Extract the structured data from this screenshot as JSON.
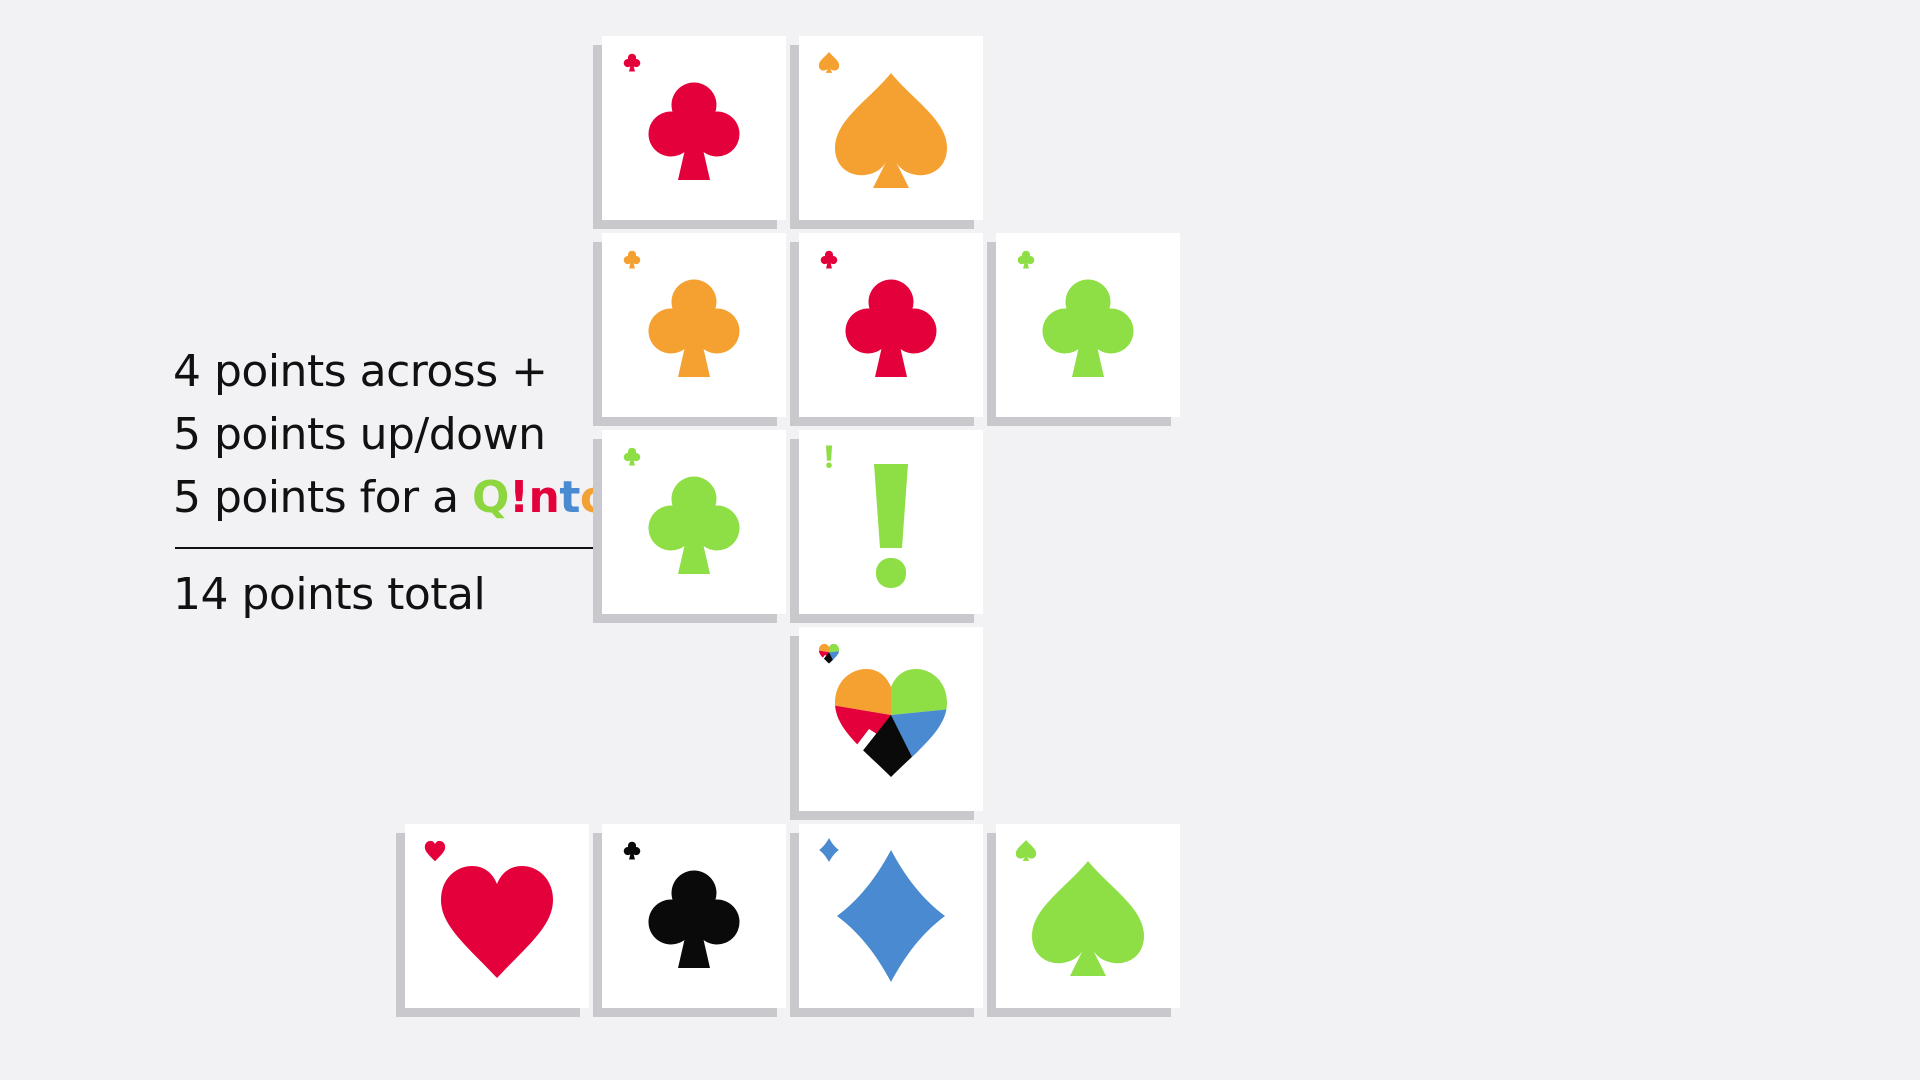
{
  "score": {
    "line1": "4 points across +",
    "line2": "5 points up/down",
    "line3_prefix": "5 points for a ",
    "qinto_letters": [
      {
        "char": "Q",
        "color": "#8dd63f"
      },
      {
        "char": "!",
        "color": "#e4003b"
      },
      {
        "char": "n",
        "color": "#e4003b"
      },
      {
        "char": "t",
        "color": "#4a8ad0"
      },
      {
        "char": "o",
        "color": "#f2a135"
      }
    ],
    "total": "14 points total"
  },
  "colors": {
    "red": "#e4003b",
    "orange": "#f5a132",
    "green": "#8ede46",
    "blue": "#4a8ad0",
    "black": "#0a0a0a"
  },
  "board": [
    {
      "row": 0,
      "col": 2,
      "suit": "club",
      "color": "red"
    },
    {
      "row": 0,
      "col": 3,
      "suit": "spade",
      "color": "orange"
    },
    {
      "row": 1,
      "col": 2,
      "suit": "club",
      "color": "orange"
    },
    {
      "row": 1,
      "col": 3,
      "suit": "club",
      "color": "red"
    },
    {
      "row": 1,
      "col": 4,
      "suit": "club",
      "color": "green"
    },
    {
      "row": 2,
      "col": 2,
      "suit": "club",
      "color": "green"
    },
    {
      "row": 2,
      "col": 3,
      "suit": "exclamation",
      "color": "green"
    },
    {
      "row": 3,
      "col": 3,
      "suit": "multicolor-heart",
      "color": "multi"
    },
    {
      "row": 4,
      "col": 1,
      "suit": "heart",
      "color": "red"
    },
    {
      "row": 4,
      "col": 2,
      "suit": "club",
      "color": "black"
    },
    {
      "row": 4,
      "col": 3,
      "suit": "diamond",
      "color": "blue"
    },
    {
      "row": 4,
      "col": 4,
      "suit": "spade",
      "color": "green"
    }
  ]
}
